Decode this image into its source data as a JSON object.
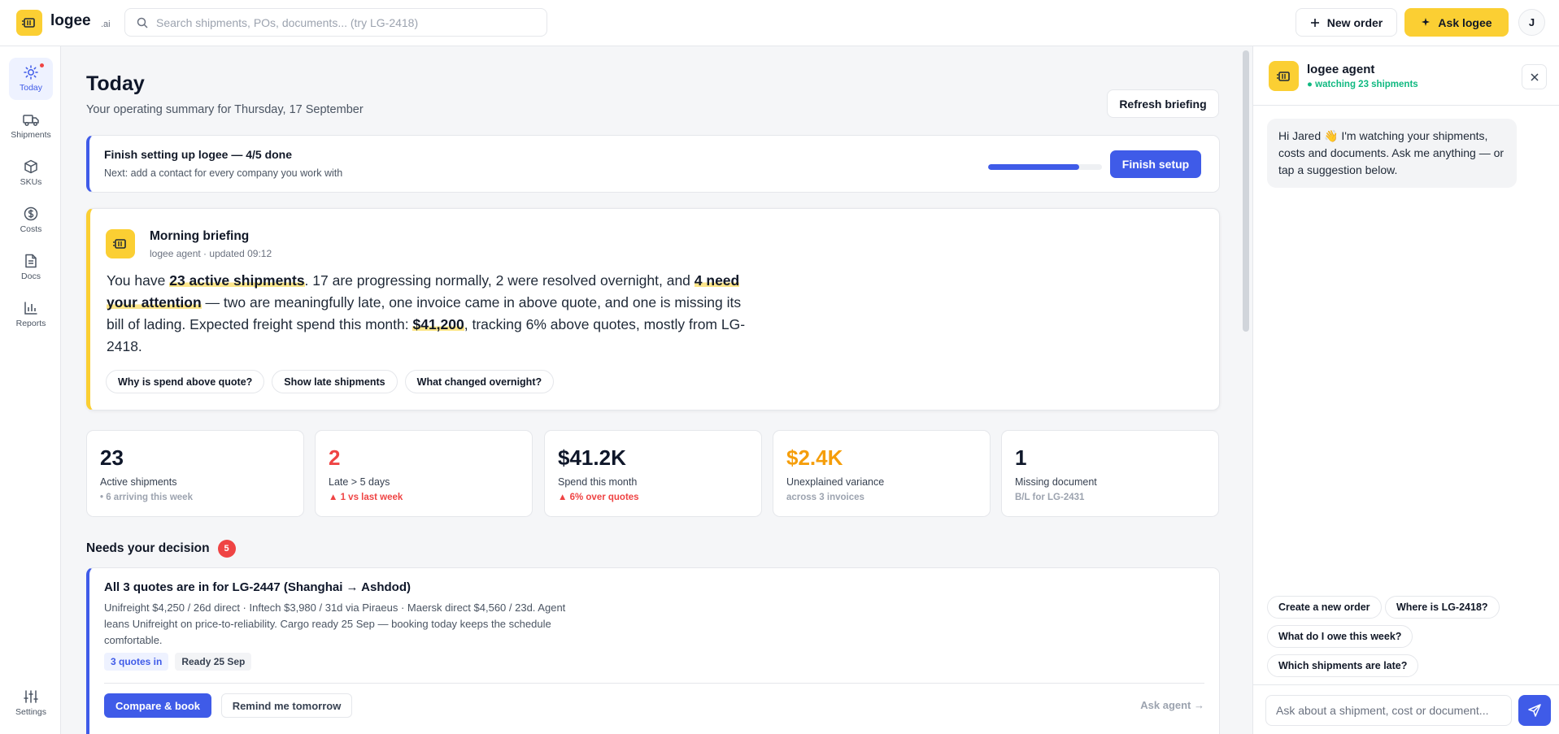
{
  "app": {
    "name": "logee",
    "suffix": ".ai",
    "brand_color": "#fbcf33",
    "accent_color": "#3f5be8"
  },
  "header": {
    "search_placeholder": "Search shipments, POs, documents... (try LG-2418)",
    "new_order_label": "New order",
    "ask_label": "Ask logee",
    "avatar_initial": "J"
  },
  "nav": {
    "items": [
      {
        "label": "Today",
        "icon": "sun-icon",
        "active": true
      },
      {
        "label": "Shipments",
        "icon": "truck-icon"
      },
      {
        "label": "SKUs",
        "icon": "box-icon"
      },
      {
        "label": "Costs",
        "icon": "dollar-icon"
      },
      {
        "label": "Docs",
        "icon": "document-icon"
      },
      {
        "label": "Reports",
        "icon": "bar-chart-icon"
      }
    ],
    "settings_label": "Settings"
  },
  "page": {
    "title": "Today",
    "subtitle": "Your operating summary for Thursday, 17 September",
    "refresh_label": "Refresh briefing"
  },
  "setup": {
    "title": "Finish setting up logee — 4/5 done",
    "subtitle": "Next: add a contact for every company you work with",
    "progress": 0.8,
    "button_label": "Finish setup"
  },
  "briefing": {
    "title": "Morning briefing",
    "meta": "logee agent · updated 09:12",
    "text_1": "You have ",
    "hl_1": "23 active shipments",
    "text_2": ". 17 are progressing normally, 2 were resolved overnight, and ",
    "hl_2": "4 need your attention",
    "text_3": " — two are meaningfully late, one invoice came in above quote, and one is missing its bill of lading. Expected freight spend this month: ",
    "hl_3": "$41,200",
    "text_4": ", tracking 6% above quotes, mostly from LG-2418.",
    "chips": [
      "Why is spend above quote?",
      "Show late shipments",
      "What changed overnight?"
    ]
  },
  "stats": [
    {
      "value": "23",
      "label": "Active shipments",
      "sub": "• 6 arriving this week"
    },
    {
      "value": "2",
      "label": "Late > 5 days",
      "sub": "▲ 1 vs last week"
    },
    {
      "value": "$41.2K",
      "label": "Spend this month",
      "sub": "▲ 6% over quotes"
    },
    {
      "value": "$2.4K",
      "label": "Unexplained variance",
      "sub": "across 3 invoices"
    },
    {
      "value": "1",
      "label": "Missing document",
      "sub": "B/L for LG-2431"
    }
  ],
  "decisions": {
    "title": "Needs your decision",
    "count": "5",
    "items": [
      {
        "title": "All 3 quotes are in for LG-2447 (Shanghai → Ashdod)",
        "body": "Unifreight $4,250 / 26d direct · Inftech $3,980 / 31d via Piraeus · Maersk direct $4,560 / 23d. Agent leans Unifreight on price-to-reliability. Cargo ready 25 Sep — booking today keeps the schedule comfortable.",
        "tags": [
          "3 quotes in",
          "Ready 25 Sep"
        ],
        "primary": "Compare & book",
        "secondary": "Remind me tomorrow",
        "link": "Ask agent →"
      }
    ]
  },
  "agent": {
    "name": "logee agent",
    "status": "● watching 23 shipments",
    "greeting": "Hi Jared 👋 I'm watching your shipments, costs and documents. Ask me anything — or tap a suggestion below.",
    "suggestions": [
      "Create a new order",
      "Where is LG-2418?",
      "What do I owe this week?",
      "Which shipments are late?"
    ],
    "input_placeholder": "Ask about a shipment, cost or document..."
  }
}
